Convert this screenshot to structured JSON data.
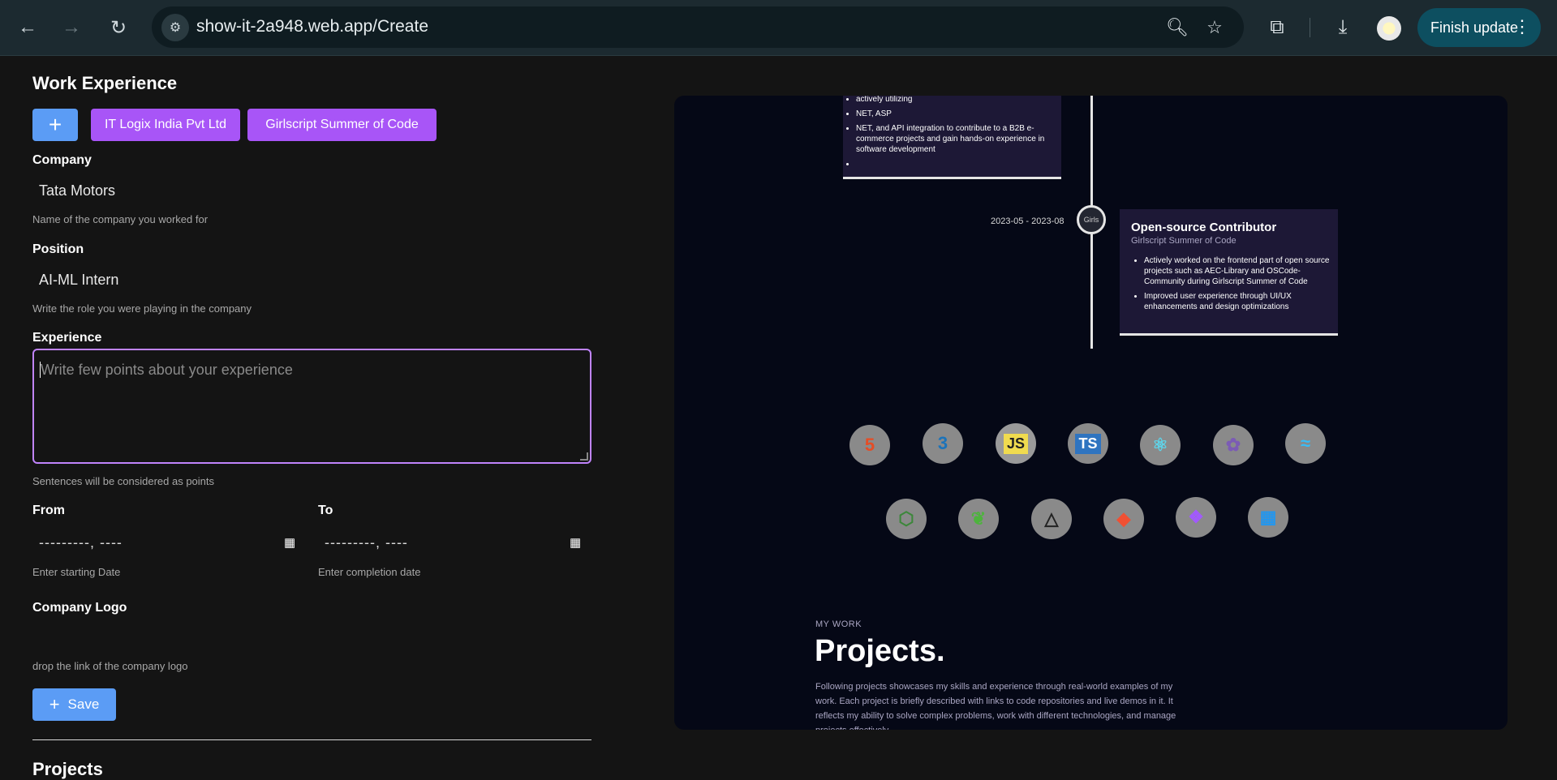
{
  "browser": {
    "url": "show-it-2a948.web.app/Create",
    "finish_update": "Finish update",
    "icons": [
      "back-icon",
      "forward-icon",
      "reload-icon",
      "site-info-icon",
      "zoom-icon",
      "star-icon",
      "extensions-icon",
      "download-icon",
      "avatar",
      "menu-icon"
    ]
  },
  "form": {
    "section_title": "Work Experience",
    "add_label": "+",
    "chips": [
      "IT Logix India Pvt Ltd",
      "Girlscript Summer of Code"
    ],
    "company": {
      "label": "Company",
      "value": "Tata Motors",
      "help": "Name of the company you worked for"
    },
    "position": {
      "label": "Position",
      "value": "AI-ML Intern",
      "help": "Write the role you were playing in the company"
    },
    "experience": {
      "label": "Experience",
      "placeholder": "Write few points about your experience",
      "help": "Sentences will be considered as points"
    },
    "from": {
      "label": "From",
      "value": "---------, ----",
      "help": "Enter starting Date"
    },
    "to": {
      "label": "To",
      "value": "---------, ----",
      "help": "Enter completion date"
    },
    "logo": {
      "label": "Company Logo",
      "help": "drop the link of the company logo"
    },
    "save_label": "Save",
    "next_section": "Projects"
  },
  "preview": {
    "card1_points": [
      "actively utilizing",
      "NET, ASP",
      "NET, and API integration to contribute to a B2B e-commerce projects and gain hands-on experience in software development",
      ""
    ],
    "card2": {
      "date": "2023-05 - 2023-08",
      "icon_alt": "Girls",
      "title": "Open-source Contributor",
      "company": "Girlscript Summer of Code",
      "points": [
        "Actively worked on the frontend part of open source projects such as AEC-Library and OSCode-Community during Girlscript Summer of Code",
        "Improved user experience through UI/UX enhancements and design optimizations"
      ]
    },
    "tech_icons": [
      "html-icon",
      "css-icon",
      "javascript-icon",
      "typescript-icon",
      "react-icon",
      "redux-icon",
      "tailwind-icon",
      "nodejs-icon",
      "mongodb-icon",
      "threejs-icon",
      "git-icon",
      "figma-icon",
      "docker-icon"
    ],
    "tech_glyphs": {
      "html": "5",
      "css": "3",
      "js": "JS",
      "ts": "TS"
    },
    "mywork": "MY WORK",
    "projects_title": "Projects.",
    "projects_text": "Following projects showcases my skills and experience through real-world examples of my work. Each project is briefly described with links to code repositories and live demos in it. It reflects my ability to solve complex problems, work with different technologies, and manage projects effectively."
  },
  "colors": {
    "accent_blue": "#5b9cf5",
    "chip_purple": "#a855f7",
    "focus_border": "#c084fc",
    "preview_bg": "#050816",
    "card_bg": "#1d1836"
  }
}
